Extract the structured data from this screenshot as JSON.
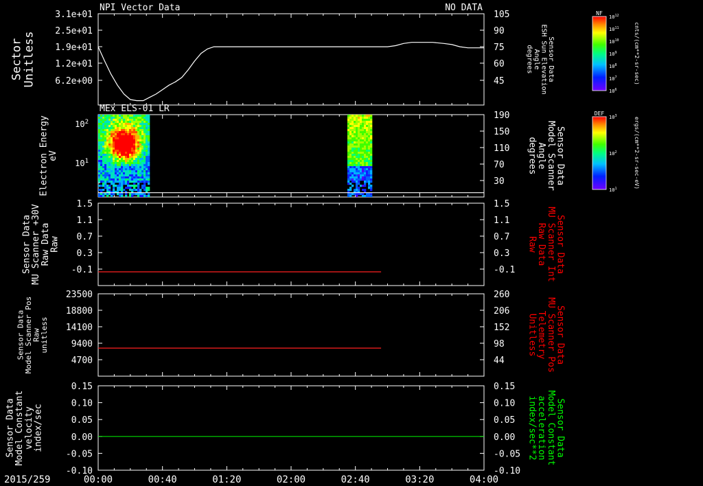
{
  "time_axis": {
    "start_min": 0,
    "end_min": 240,
    "ticks": [
      {
        "min": 0,
        "label": "00:00"
      },
      {
        "min": 40,
        "label": "00:40"
      },
      {
        "min": 80,
        "label": "01:20"
      },
      {
        "min": 120,
        "label": "02:00"
      },
      {
        "min": 160,
        "label": "02:40"
      },
      {
        "min": 200,
        "label": "03:20"
      },
      {
        "min": 240,
        "label": "04:00"
      }
    ],
    "date_label": "2015/259"
  },
  "chart_data": [
    {
      "type": "line",
      "panel": 1,
      "title": "NPI Vector Data",
      "status": "NO DATA",
      "left_axis": {
        "label_lines": [
          "Sector",
          "Unitless"
        ],
        "ticks": [
          "3.1e+01",
          "2.5e+01",
          "1.9e+01",
          "1.2e+01",
          "6.2e+00"
        ]
      },
      "right_axis": {
        "label_lines": [
          "Sensor Data",
          "ESH Sun Elevation",
          "Angle",
          "degrees"
        ],
        "range": [
          22,
          105
        ],
        "ticks": [
          105,
          90,
          75,
          60,
          45
        ]
      },
      "series": [
        {
          "color": "#ffffff",
          "x_min": [
            0,
            4,
            8,
            12,
            16,
            20,
            24,
            28,
            32,
            36,
            40,
            44,
            48,
            52,
            56,
            60,
            64,
            68,
            72,
            76,
            80,
            84,
            90,
            100,
            120,
            150,
            180,
            185,
            190,
            195,
            200,
            208,
            215,
            220,
            225,
            230,
            235,
            240
          ],
          "y": [
            75,
            62,
            50,
            40,
            32,
            27,
            26,
            26,
            29,
            32,
            36,
            40,
            43,
            47,
            54,
            62,
            69,
            73,
            75,
            75,
            75,
            75,
            75,
            75,
            75,
            75,
            75,
            76,
            78,
            79,
            79,
            79,
            78,
            77,
            75,
            74,
            74,
            74
          ]
        }
      ]
    },
    {
      "type": "heatmap",
      "panel": 2,
      "title": "MEx ELS-01 LR",
      "left_axis": {
        "label_lines": [
          "Electron Energy",
          "eV"
        ],
        "scale": "log",
        "range": [
          1.3,
          170
        ],
        "ticks": [
          {
            "v": 100,
            "label": "10",
            "sup": "2"
          },
          {
            "v": 10,
            "label": "10",
            "sup": "1"
          }
        ]
      },
      "right_axis": {
        "label_lines": [
          "Sensor Data",
          "Model Scanner",
          "Angle",
          "degrees"
        ],
        "range": [
          0,
          190
        ],
        "ticks": [
          190,
          150,
          110,
          70,
          30
        ]
      },
      "line_series": [
        {
          "color": "#ffffff",
          "x_min": [
            0,
            240
          ],
          "y": [
            10,
            10
          ]
        }
      ],
      "blocks": [
        {
          "start_min": 0,
          "end_min": 31,
          "profile": "active"
        },
        {
          "start_min": 155,
          "end_min": 170,
          "profile": "moderate"
        }
      ]
    },
    {
      "type": "line",
      "panel": 3,
      "left_axis": {
        "label_lines": [
          "Sensor Data",
          "MU Scanner +30V",
          "Raw Data",
          "Raw"
        ],
        "range": [
          -0.3,
          1.5
        ],
        "ticks": [
          1.5,
          1.1,
          0.7,
          0.3,
          -0.1
        ]
      },
      "right_axis": {
        "label_lines": [
          "Sensor Data",
          "MU Scanner Int",
          "Raw Data",
          "Raw"
        ],
        "color": "#ff0000",
        "range": [
          -0.3,
          1.5
        ],
        "ticks": [
          1.5,
          1.1,
          0.7,
          0.3,
          -0.1
        ]
      },
      "series": [
        {
          "color": "#ff2020",
          "x_min": [
            0,
            176
          ],
          "y": [
            0.0,
            0.0
          ]
        }
      ]
    },
    {
      "type": "line",
      "panel": 4,
      "left_axis": {
        "label_lines": [
          "Sensor Data",
          "Model Scanner Pos",
          "Raw",
          "unitless"
        ],
        "range": [
          0,
          23500
        ],
        "ticks": [
          23500,
          18800,
          14100,
          9400,
          4700
        ]
      },
      "right_axis": {
        "label_lines": [
          "Sensor Data",
          "MU Scanner Pos",
          "Telemetry",
          "Unitless"
        ],
        "color": "#ff0000",
        "range": [
          0,
          260
        ],
        "ticks": [
          260,
          206,
          152,
          98,
          44
        ]
      },
      "series": [
        {
          "color": "#ff2020",
          "x_min": [
            0,
            176
          ],
          "y": [
            8000,
            8000
          ]
        }
      ]
    },
    {
      "type": "line",
      "panel": 5,
      "left_axis": {
        "label_lines": [
          "Sensor Data",
          "Model Constant",
          "velocity",
          "index/sec"
        ],
        "range": [
          -0.1,
          0.15
        ],
        "ticks": [
          "0.15",
          "0.10",
          "0.05",
          "0.00",
          "-0.05",
          "-0.10"
        ]
      },
      "right_axis": {
        "label_lines": [
          "Sensor Data",
          "Model Constant",
          "acceleration",
          "index/sec**2"
        ],
        "color": "#00ff00",
        "range": [
          -0.1,
          0.15
        ],
        "ticks": [
          "0.15",
          "0.10",
          "0.05",
          "0.00",
          "-0.05",
          "-0.10"
        ]
      },
      "series": [
        {
          "color": "#00dd00",
          "x_min": [
            0,
            240
          ],
          "y": [
            0,
            0
          ]
        }
      ]
    }
  ],
  "colorbars": [
    {
      "label": "NF",
      "unit": "cnts/(cm**2-sr-sec)",
      "ticks": [
        {
          "b": "10",
          "s": "12"
        },
        {
          "b": "10",
          "s": "11"
        },
        {
          "b": "10",
          "s": "10"
        },
        {
          "b": "10",
          "s": "9"
        },
        {
          "b": "10",
          "s": "8"
        },
        {
          "b": "10",
          "s": "7"
        },
        {
          "b": "10",
          "s": "6"
        }
      ]
    },
    {
      "label": "DEF",
      "unit": "ergs/(cm**2-sr-sec-eV)",
      "ticks": [
        {
          "b": "10",
          "s": "3"
        },
        {
          "b": "10",
          "s": "2"
        },
        {
          "b": "10",
          "s": "1"
        }
      ]
    }
  ]
}
